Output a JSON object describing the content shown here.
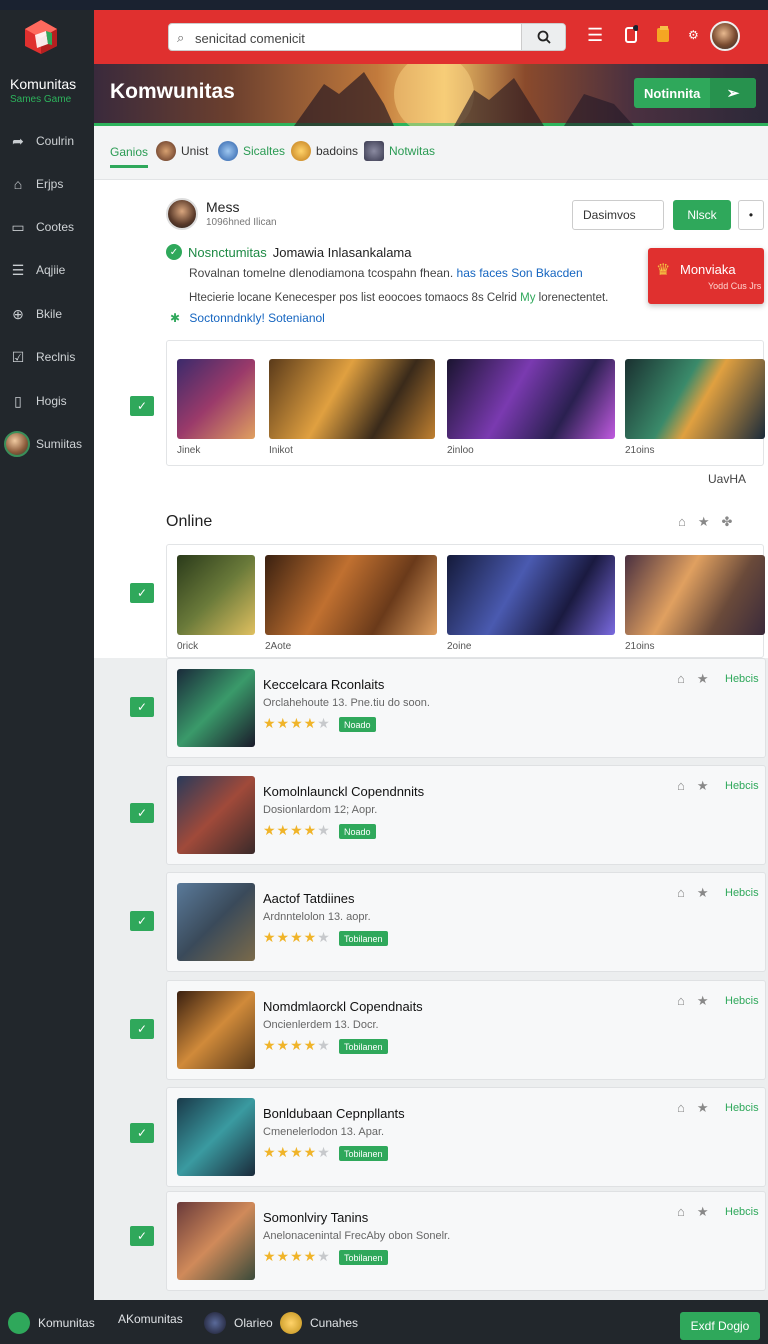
{
  "sidebar": {
    "brand": "Komunitas",
    "brand_sub": "Sames Game",
    "items": [
      {
        "label": "Coulrin",
        "icon": "share-arrow-icon"
      },
      {
        "label": "Erjps",
        "icon": "home-icon"
      },
      {
        "label": "Cootes",
        "icon": "inbox-icon"
      },
      {
        "label": "Aqjiie",
        "icon": "layers-icon"
      },
      {
        "label": "Bkile",
        "icon": "gamepad-icon"
      },
      {
        "label": "Reclnis",
        "icon": "check-box-icon"
      },
      {
        "label": "Hogis",
        "icon": "clipboard-icon"
      },
      {
        "label": "Sumiitas",
        "icon": "avatar-icon"
      }
    ]
  },
  "header": {
    "search_value": "senicitad comenicit",
    "icons": [
      "menu-icon",
      "notification-icon",
      "wallet-icon",
      "settings-icon"
    ]
  },
  "hero": {
    "title": "Komwunitas",
    "button_label": "Notinnita"
  },
  "tabs": [
    {
      "label": "Ganios",
      "active": true
    },
    {
      "label": "Unist",
      "active": false
    },
    {
      "label": "Sicaltes",
      "active": false
    },
    {
      "label": "badoins",
      "active": false
    },
    {
      "label": "Notwitas",
      "active": false
    }
  ],
  "post": {
    "name": "Mess",
    "meta": "1096hned Ilican",
    "btn_outline": "Dasimvos",
    "btn_green": "Nlsck",
    "btn_more": "•",
    "line1_highlight": "Nosnctumitas",
    "line1_text": "Jomawia Inlasankalama",
    "line2_pre": "Rovalnan tomelne dlenodiamona tcospahn fhean.",
    "line2_hl": "has faces Son Bkacden",
    "line3_pre": "Htecierie locane Kenecesper pos list eoocoes tomaocs 8s Celrid",
    "line3_g": "My",
    "line3_post": "lorenectentet.",
    "line4": "Soctonndnkly! Sotenianol"
  },
  "promo": {
    "title": "Monviaka",
    "sub": "Yodd Cus Jrs"
  },
  "gallery1": {
    "labels": [
      "Jinek",
      "Inikot",
      "2inloo",
      "21oins"
    ]
  },
  "gallery_label": "UavHA",
  "online_title": "Online",
  "gallery2": {
    "labels": [
      "0rick",
      "2Aote",
      "2oine",
      "21oins"
    ]
  },
  "cards": [
    {
      "title": "Keccelcara Rconlaits",
      "sub": "Orclahehoute 13. Pne.tiu do soon.",
      "rating": 4,
      "badge": "Noado",
      "action": "Hebcis"
    },
    {
      "title": "Komolnlaunckl Copendnnits",
      "sub": "Dosionlardom 12; Aopr.",
      "rating": 4,
      "badge": "Noado",
      "action": "Hebcis"
    },
    {
      "title": "Aactof Tatdiines",
      "sub": "Ardnntelolon 13. aopr.",
      "rating": 4,
      "badge": "Tobilanen",
      "action": "Hebcis"
    },
    {
      "title": "Nomdmlaorckl Copendnaits",
      "sub": "Oncienlerdem 13. Docr.",
      "rating": 4,
      "badge": "Tobilanen",
      "action": "Hebcis"
    },
    {
      "title": "Bonldubaan Cepnpllants",
      "sub": "Cmenelerlodon 13. Apar.",
      "rating": 4,
      "badge": "Tobilanen",
      "action": "Hebcis"
    },
    {
      "title": "Somonlviry Tanins",
      "sub": "Anelonacenintal FrecAby obon Sonelr.",
      "rating": 4,
      "badge": "Tobilanen",
      "action": "Hebcis"
    }
  ],
  "footer": {
    "items": [
      "Komunitas",
      "AKomunitas",
      "Olarieo",
      "Cunahes"
    ],
    "button": "Exdf Dogjo"
  },
  "colors": {
    "accent": "#2fa85b",
    "header": "#e0302f",
    "sidebar": "#22272c"
  }
}
